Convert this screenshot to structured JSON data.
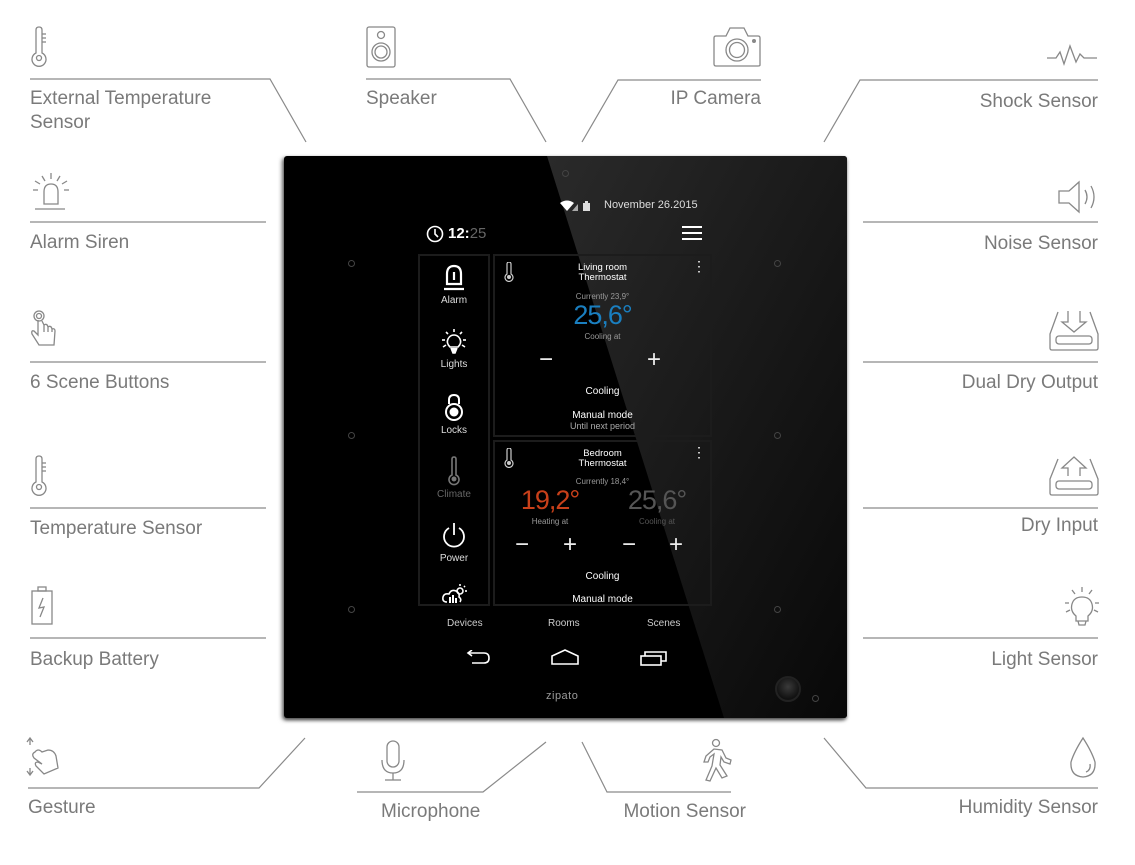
{
  "features_left": [
    {
      "label": "External Temperature Sensor",
      "icon": "thermometer-icon"
    },
    {
      "label": "Alarm Siren",
      "icon": "siren-icon"
    },
    {
      "label": "6 Scene Buttons",
      "icon": "touch-hand-icon"
    },
    {
      "label": "Temperature Sensor",
      "icon": "thermometer-icon"
    },
    {
      "label": "Backup Battery",
      "icon": "battery-icon"
    }
  ],
  "features_right": [
    {
      "label": "Shock Sensor",
      "icon": "pulse-icon"
    },
    {
      "label": "Noise Sensor",
      "icon": "speaker-sound-icon"
    },
    {
      "label": "Dual Dry Output",
      "icon": "tray-down-icon"
    },
    {
      "label": "Dry Input",
      "icon": "tray-up-icon"
    },
    {
      "label": "Light Sensor",
      "icon": "light-bulb-icon"
    }
  ],
  "features_top": [
    {
      "label": "Speaker",
      "icon": "speaker-box-icon"
    },
    {
      "label": "IP Camera",
      "icon": "camera-icon"
    }
  ],
  "features_bottom": [
    {
      "label": "Gesture",
      "icon": "gesture-icon"
    },
    {
      "label": "Microphone",
      "icon": "microphone-icon"
    },
    {
      "label": "Motion Sensor",
      "icon": "walking-person-icon"
    },
    {
      "label": "Humidity Sensor",
      "icon": "water-drop-icon"
    }
  ],
  "device": {
    "brand": "zipato",
    "status_bar": {
      "date": "November 26.2015"
    },
    "clock": {
      "hours": "12:",
      "minutes": "25"
    },
    "sidebar": [
      {
        "label": "Alarm",
        "icon": "alarm-icon",
        "active": true
      },
      {
        "label": "Lights",
        "icon": "bulb-icon",
        "active": true
      },
      {
        "label": "Locks",
        "icon": "lock-icon",
        "active": true
      },
      {
        "label": "Climate",
        "icon": "thermometer-icon",
        "active": false
      },
      {
        "label": "Power",
        "icon": "power-icon",
        "active": true
      },
      {
        "label": "",
        "icon": "weather-icon",
        "active": true
      }
    ],
    "thermostats": [
      {
        "title_line1": "Living room",
        "title_line2": "Thermostat",
        "current": "Currently 23,9°",
        "setpoint": "25,6°",
        "setpoint_label": "Cooling at",
        "setpoint_color": "#1a7fc0",
        "mode": "Cooling",
        "manual": "Manual mode",
        "until": "Until next period"
      },
      {
        "title_line1": "Bedroom",
        "title_line2": "Thermostat",
        "current": "Currently 18,4°",
        "heat_setpoint": "19,2°",
        "heat_label": "Heating at",
        "heat_color": "#c8401a",
        "cool_setpoint": "25,6°",
        "cool_label": "Cooling at",
        "cool_color": "#555555",
        "mode": "Cooling",
        "manual": "Manual mode"
      }
    ],
    "bottom_tabs": [
      "Devices",
      "Rooms",
      "Scenes"
    ],
    "controls": {
      "minus": "−",
      "plus": "+"
    }
  }
}
